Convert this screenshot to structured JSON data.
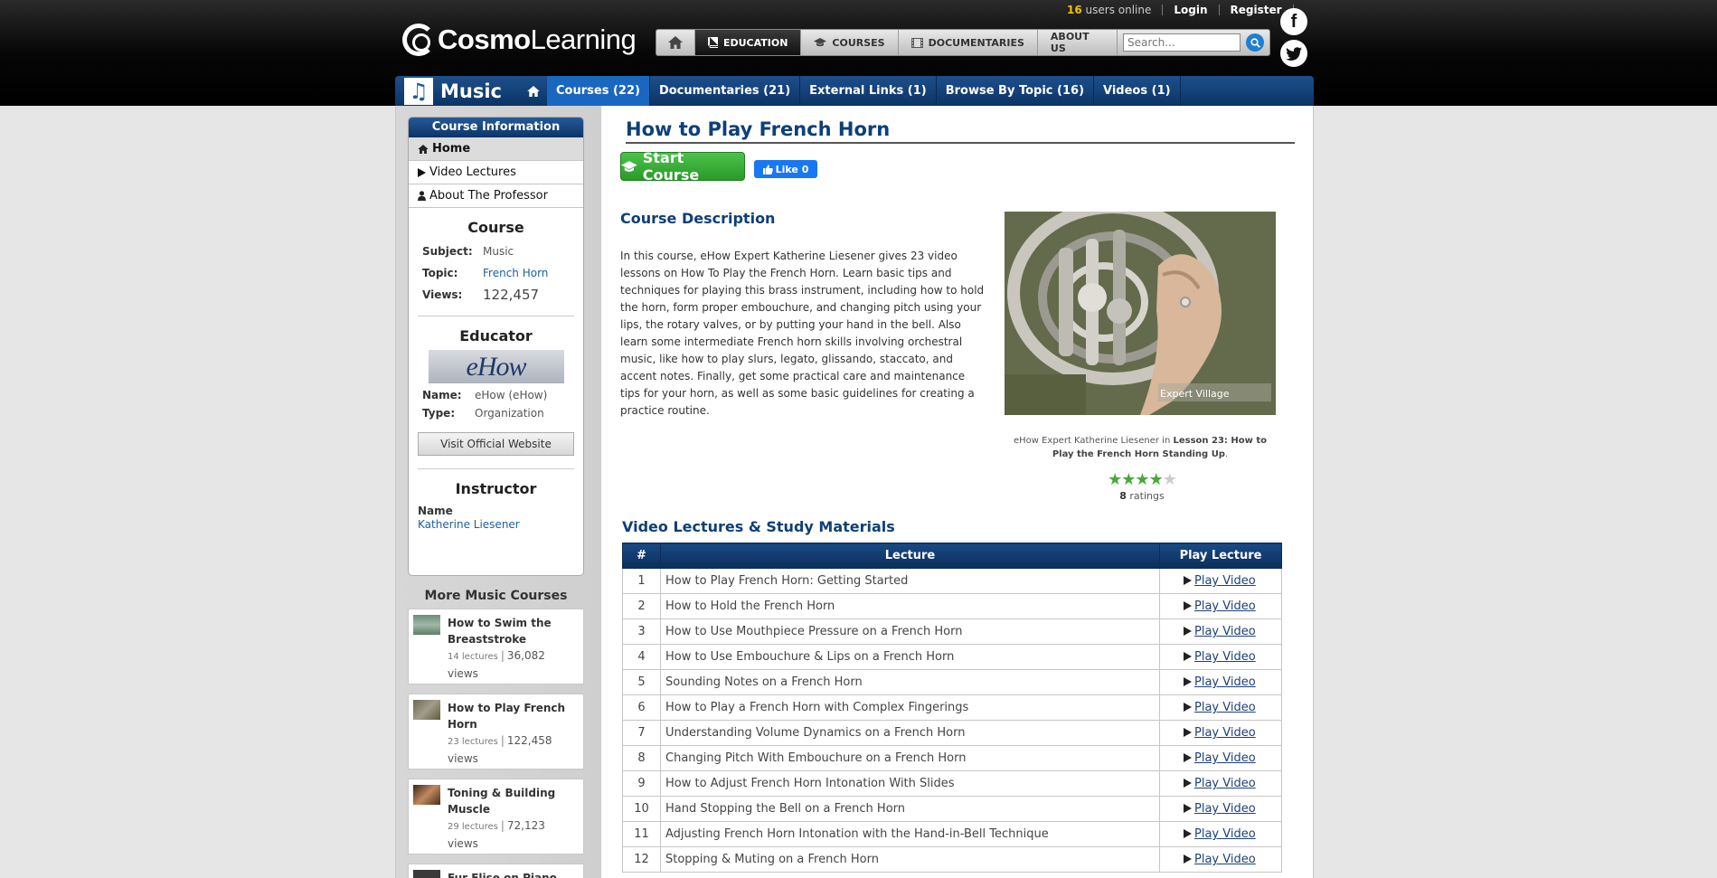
{
  "header": {
    "users_online_count": "16",
    "users_online_label": "users online",
    "login": "Login",
    "register": "Register",
    "logo_bold": "Cosmo",
    "logo_rest": "Learning",
    "nav": [
      {
        "label": "EDUCATION"
      },
      {
        "label": "COURSES"
      },
      {
        "label": "DOCUMENTARIES"
      },
      {
        "label": "ABOUT US"
      }
    ],
    "search_placeholder": "Search..."
  },
  "subject": {
    "title": "Music",
    "tabs": [
      {
        "label": "Courses (22)"
      },
      {
        "label": "Documentaries (21)"
      },
      {
        "label": "External Links (1)"
      },
      {
        "label": "Browse By Topic (16)"
      },
      {
        "label": "Videos (1)"
      }
    ]
  },
  "sidebar": {
    "card_title": "Course Information",
    "links": [
      {
        "label": "Home"
      },
      {
        "label": "Video Lectures"
      },
      {
        "label": "About The Professor"
      }
    ],
    "course_heading": "Course",
    "subject_k": "Subject:",
    "subject_v": "Music",
    "topic_k": "Topic:",
    "topic_v": "French Horn",
    "views_k": "Views:",
    "views_v": "122,457",
    "educator_heading": "Educator",
    "educator_logo": "eHow",
    "name_k": "Name:",
    "name_v": "eHow (eHow)",
    "type_k": "Type:",
    "type_v": "Organization",
    "visit_label": "Visit Official Website",
    "instructor_heading": "Instructor",
    "instructor_name_k": "Name",
    "instructor_name_v": "Katherine Liesener",
    "more_heading": "More Music Courses",
    "more": [
      {
        "title": "How to Swim the Breaststroke",
        "lectures": "14 lectures",
        "views": "36,082",
        "views_unit": "views"
      },
      {
        "title": "How to Play French Horn",
        "lectures": "23 lectures",
        "views": "122,458",
        "views_unit": "views"
      },
      {
        "title": "Toning & Building Muscle",
        "lectures": "29 lectures",
        "views": "72,123",
        "views_unit": "views"
      },
      {
        "title": "Fur Elise on Piano"
      }
    ]
  },
  "main": {
    "title": "How to Play French Horn",
    "start_label": "Start Course",
    "like_label": "Like 0",
    "desc_heading": "Course Description",
    "description": "In this course, eHow Expert Katherine Liesener gives 23 video lessons on How To Play the French Horn. Learn basic tips and techniques for playing this brass instrument, including how to hold the horn, form proper embouchure, and changing pitch using your lips, the rotary valves, or by putting your hand in the bell. Also learn some intermediate French horn skills involving orchestral music, like how to play slurs, legato, glissando, staccato, and accent notes. Finally, get some practical care and maintenance tips for your horn, as well as some basic guidelines for creating a practice routine.",
    "image_watermark": "Expert Village",
    "caption_pre": "eHow Expert Katherine Liesener in",
    "caption_bold": "Lesson 23: How to Play the French Horn Standing Up",
    "caption_post": ".",
    "rating_stars": 4,
    "rating_max": 5,
    "ratings_count": "8",
    "ratings_label": "ratings",
    "lectures_heading": "Video Lectures & Study Materials",
    "table_headers": {
      "num": "#",
      "lecture": "Lecture",
      "play": "Play Lecture"
    },
    "play_label": "Play Video",
    "lectures": [
      {
        "num": "1",
        "title": "How to Play French Horn: Getting Started"
      },
      {
        "num": "2",
        "title": "How to Hold the French Horn"
      },
      {
        "num": "3",
        "title": "How to Use Mouthpiece Pressure on a French Horn"
      },
      {
        "num": "4",
        "title": "How to Use Embouchure & Lips on a French Horn"
      },
      {
        "num": "5",
        "title": "Sounding Notes on a French Horn"
      },
      {
        "num": "6",
        "title": "How to Play a French Horn with Complex Fingerings"
      },
      {
        "num": "7",
        "title": "Understanding Volume Dynamics on a French Horn"
      },
      {
        "num": "8",
        "title": "Changing Pitch With Embouchure on a French Horn"
      },
      {
        "num": "9",
        "title": "How to Adjust French Horn Intonation With Slides"
      },
      {
        "num": "10",
        "title": "Hand Stopping the Bell on a French Horn"
      },
      {
        "num": "11",
        "title": "Adjusting French Horn Intonation with the Hand-in-Bell Technique"
      },
      {
        "num": "12",
        "title": "Stopping & Muting on a French Horn"
      }
    ]
  }
}
